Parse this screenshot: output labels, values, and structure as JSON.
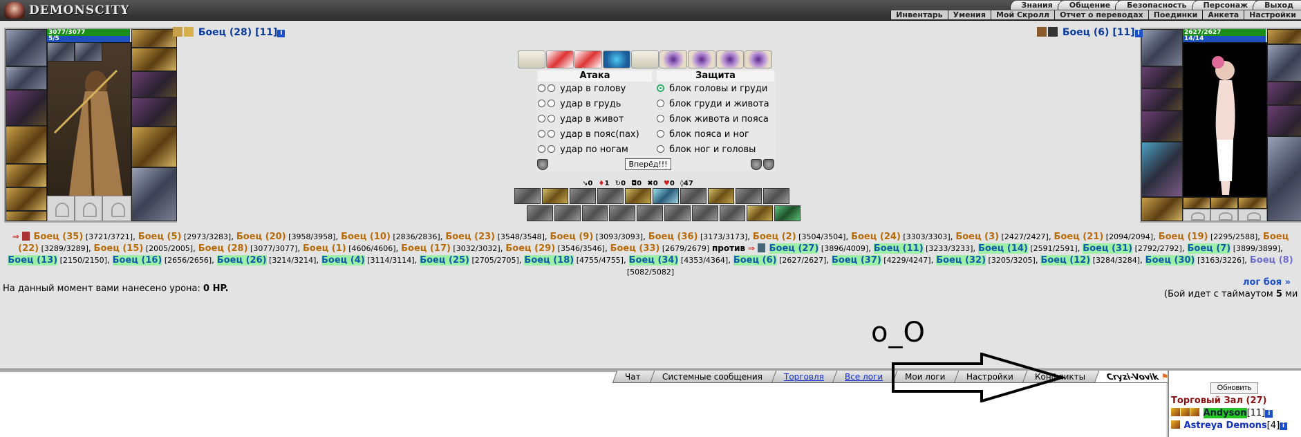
{
  "app": {
    "logo": "DEMONSCITY"
  },
  "top_tabs": [
    "Знания",
    "Общение",
    "Безопасность",
    "Персонаж",
    "Выход"
  ],
  "sub_tabs": [
    "Инвентарь",
    "Умения",
    "Мой Скролл",
    "Отчет о переводах",
    "Поединки",
    "Анкета",
    "Настройки"
  ],
  "player": {
    "hp": "3077/3077",
    "mp": "5/5",
    "name": "Боец (28)",
    "level": "[11]"
  },
  "opponent": {
    "hp": "2627/2627",
    "mp": "14/14",
    "name": "Боец (6)",
    "level": "[11]"
  },
  "info_icon": "i",
  "combat": {
    "attack_header": "Атака",
    "defense_header": "Защита",
    "attacks": [
      "удар в голову",
      "удар в грудь",
      "удар в живот",
      "удар в пояс(пах)",
      "удар по ногам"
    ],
    "defenses": [
      "блок головы и груди",
      "блок груди и живота",
      "блок живота и пояса",
      "блок пояса и ног",
      "блок ног и головы"
    ],
    "selected_defense": 0,
    "go_button": "Вперёд!!!"
  },
  "stats": [
    "0",
    "1",
    "0",
    "0",
    "0",
    "0",
    "47"
  ],
  "fighters": {
    "team1": [
      {
        "name": "Боец (35)",
        "hp": "[3721/3721]"
      },
      {
        "name": "Боец (5)",
        "hp": "[2973/3283]"
      },
      {
        "name": "Боец (20)",
        "hp": "[3958/3958]"
      },
      {
        "name": "Боец (10)",
        "hp": "[2836/2836]"
      },
      {
        "name": "Боец (23)",
        "hp": "[3548/3548]"
      },
      {
        "name": "Боец (9)",
        "hp": "[3093/3093]"
      },
      {
        "name": "Боец (36)",
        "hp": "[3173/3173]"
      },
      {
        "name": "Боец (2)",
        "hp": "[3504/3504]"
      },
      {
        "name": "Боец (24)",
        "hp": "[3303/3303]"
      },
      {
        "name": "Боец (3)",
        "hp": "[2427/2427]"
      },
      {
        "name": "Боец (21)",
        "hp": "[2094/2094]"
      },
      {
        "name": "Боец (19)",
        "hp": "[2295/2588]"
      },
      {
        "name": "Боец (22)",
        "hp": "[3289/3289]"
      },
      {
        "name": "Боец (15)",
        "hp": "[2005/2005]"
      },
      {
        "name": "Боец (28)",
        "hp": "[3077/3077]"
      },
      {
        "name": "Боец (1)",
        "hp": "[4606/4606]"
      },
      {
        "name": "Боец (17)",
        "hp": "[3032/3032]"
      },
      {
        "name": "Боец (29)",
        "hp": "[3546/3546]"
      },
      {
        "name": "Боец (33)",
        "hp": "[2679/2679]"
      }
    ],
    "vs": "против",
    "team2": [
      {
        "name": "Боец (27)",
        "hp": "[3896/4009]"
      },
      {
        "name": "Боец (11)",
        "hp": "[3233/3233]"
      },
      {
        "name": "Боец (14)",
        "hp": "[2591/2591]"
      },
      {
        "name": "Боец (31)",
        "hp": "[2792/2792]"
      },
      {
        "name": "Боец (7)",
        "hp": "[3899/3899]"
      },
      {
        "name": "Боец (13)",
        "hp": "[2150/2150]"
      },
      {
        "name": "Боец (16)",
        "hp": "[2656/2656]"
      },
      {
        "name": "Боец (26)",
        "hp": "[3214/3214]"
      },
      {
        "name": "Боец (4)",
        "hp": "[3114/3114]"
      },
      {
        "name": "Боец (25)",
        "hp": "[2705/2705]"
      },
      {
        "name": "Боец (18)",
        "hp": "[4755/4755]"
      },
      {
        "name": "Боец (34)",
        "hp": "[4353/4364]"
      },
      {
        "name": "Боец (6)",
        "hp": "[2627/2627]"
      },
      {
        "name": "Боец (37)",
        "hp": "[4229/4247]"
      },
      {
        "name": "Боец (32)",
        "hp": "[3205/3205]"
      },
      {
        "name": "Боец (12)",
        "hp": "[3284/3284]"
      },
      {
        "name": "Боец (30)",
        "hp": "[3163/3226]"
      },
      {
        "name": "Боец (8)",
        "hp": "[5082/5082]"
      }
    ]
  },
  "damage": {
    "text": "На данный момент вами нанесено урона:",
    "value": "0 HP."
  },
  "log_link": "лог боя »",
  "timeout": {
    "text": "(Бой идет с таймаутом",
    "value": "5",
    "unit": "ми"
  },
  "annotation": "o_O",
  "chat_tabs": [
    "Чат",
    "Системные сообщения",
    "Торговля",
    "Все логи",
    "Мои логи",
    "Настройки",
    "Конфликты",
    "Cryzi-Vovik"
  ],
  "sidebar": {
    "refresh": "Обновить",
    "room": "Торговый Зал (27)",
    "users": [
      {
        "name": "Andyson",
        "level": "[11]"
      },
      {
        "name": "Astreya Demons",
        "level": "[4]"
      }
    ]
  }
}
